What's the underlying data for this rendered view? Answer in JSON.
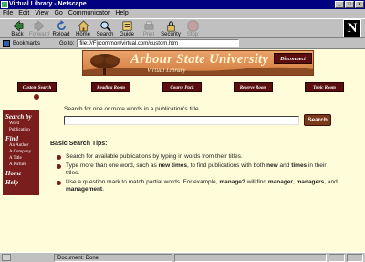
{
  "window": {
    "title": "Virtual Library - Netscape"
  },
  "menu": [
    "File",
    "Edit",
    "View",
    "Go",
    "Communicator",
    "Help"
  ],
  "toolbar": {
    "back": "Back",
    "forward": "Forward",
    "reload": "Reload",
    "home": "Home",
    "search": "Search",
    "guide": "Guide",
    "print": "Print",
    "security": "Security",
    "stop": "Stop"
  },
  "location": {
    "bookmarks_label": "Bookmarks",
    "goto_label": "Go to:",
    "url": "file:///F|/common/virtual.com/custom.htm"
  },
  "banner": {
    "title": "Arbour State University",
    "subtitle": "Virtual Library",
    "disconnect": "Disconnect"
  },
  "nav": [
    "Custom Search",
    "Reading Room",
    "Course Pack",
    "Reserve Room",
    "Topic Room"
  ],
  "sidebar": {
    "search_by": "Search by",
    "search_items": [
      "Word",
      "Publication"
    ],
    "find": "Find",
    "find_items": [
      "An Author",
      "A Company",
      "A Title",
      "A Picture"
    ],
    "home": "Home",
    "help": "Help"
  },
  "search": {
    "prompt": "Search for one or more words in a publication's title.",
    "value": "",
    "button": "Search"
  },
  "tips": {
    "title": "Basic Search Tips:",
    "items": [
      "Search for available publications by typing in words from their titles.",
      "Type more than one word, such as <b>new times</b>, to find publications with both <b>new</b> and <b>times</b> in their titles.",
      "Use a question mark to match partial words. For example, <b>manage?</b> will find <b>manager</b>, <b>managers</b>, and <b>management</b>."
    ]
  },
  "status": {
    "text": "Document: Done"
  },
  "colors": {
    "accent": "#7a1d1d",
    "banner": "#d37c3f",
    "page_bg": "#fffcd9",
    "titlebar": "#000080"
  }
}
